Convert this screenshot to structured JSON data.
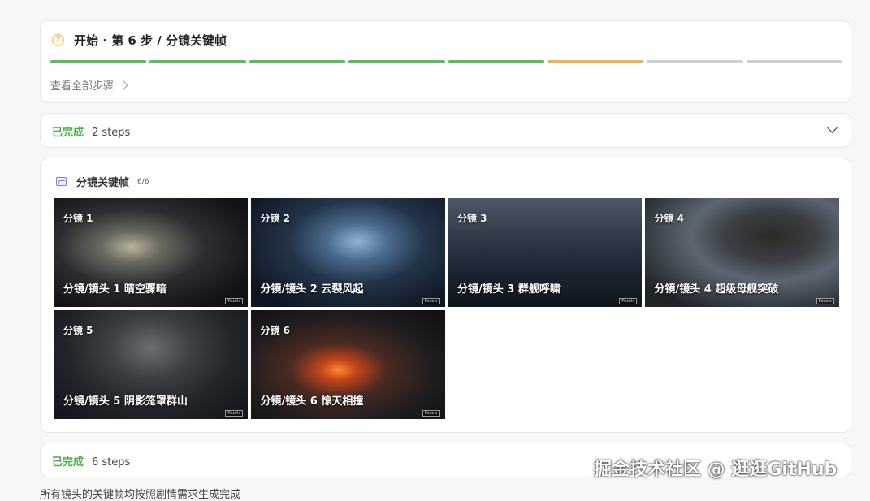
{
  "progress": {
    "title": "开始 · 第 6 步 / 分镜关键帧",
    "view_all": "查看全部步骤",
    "steps": [
      {
        "state": "done"
      },
      {
        "state": "done"
      },
      {
        "state": "done"
      },
      {
        "state": "done"
      },
      {
        "state": "done"
      },
      {
        "state": "current"
      },
      {
        "state": "pending"
      },
      {
        "state": "pending"
      }
    ],
    "icon": "question-icon"
  },
  "completed_1": {
    "label": "已完成",
    "count": "2 steps"
  },
  "keyframes": {
    "title": "分镜关键帧",
    "count": "6/6",
    "icon": "image-icon",
    "shots": [
      {
        "tag": "分镜 1",
        "caption": "分镜/镜头 1 晴空骤暗",
        "mark": "Pexels"
      },
      {
        "tag": "分镜 2",
        "caption": "分镜/镜头 2 云裂风起",
        "mark": "Pexels"
      },
      {
        "tag": "分镜 3",
        "caption": "分镜/镜头 3 群舰呼啸",
        "mark": "Pexels"
      },
      {
        "tag": "分镜 4",
        "caption": "分镜/镜头 4 超级母舰突破",
        "mark": "Pexels"
      },
      {
        "tag": "分镜 5",
        "caption": "分镜/镜头 5 阴影笼罩群山",
        "mark": "Pexels"
      },
      {
        "tag": "分镜 6",
        "caption": "分镜/镜头 6 惊天相撞",
        "mark": "Pexels"
      }
    ]
  },
  "completed_2": {
    "label": "已完成",
    "count": "6 steps"
  },
  "watermark": "掘金技术社区 @ 逛逛GitHub",
  "bottom_text": "所有镜头的关键帧均按照剧情需求生成完成"
}
